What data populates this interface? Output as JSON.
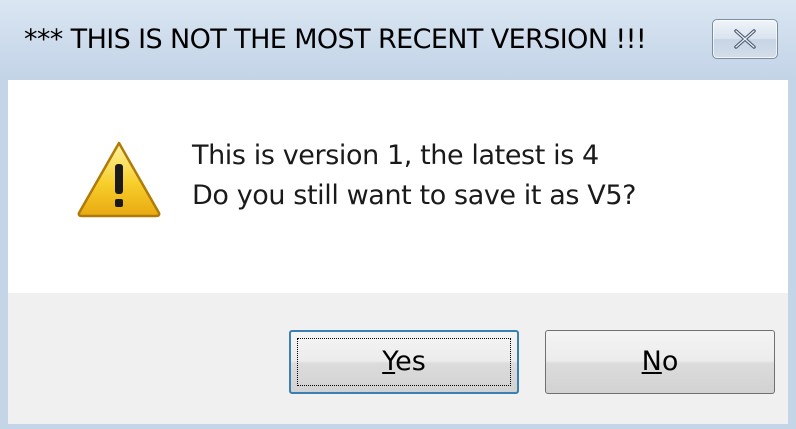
{
  "dialog": {
    "title": "*** THIS IS NOT THE MOST RECENT VERSION !!!",
    "icon": "warning-icon",
    "message_line1": "This is version 1, the latest is 4",
    "message_line2": "Do you still want to save it as V5?",
    "close_icon": "close-icon"
  },
  "buttons": {
    "yes": {
      "mnemonic": "Y",
      "rest": "es"
    },
    "no": {
      "mnemonic": "N",
      "rest": "o"
    }
  },
  "colors": {
    "titlebar": "#cfdded",
    "body": "#ffffff",
    "footer": "#f0f0f0",
    "default_button_border": "#3c7fb1"
  }
}
